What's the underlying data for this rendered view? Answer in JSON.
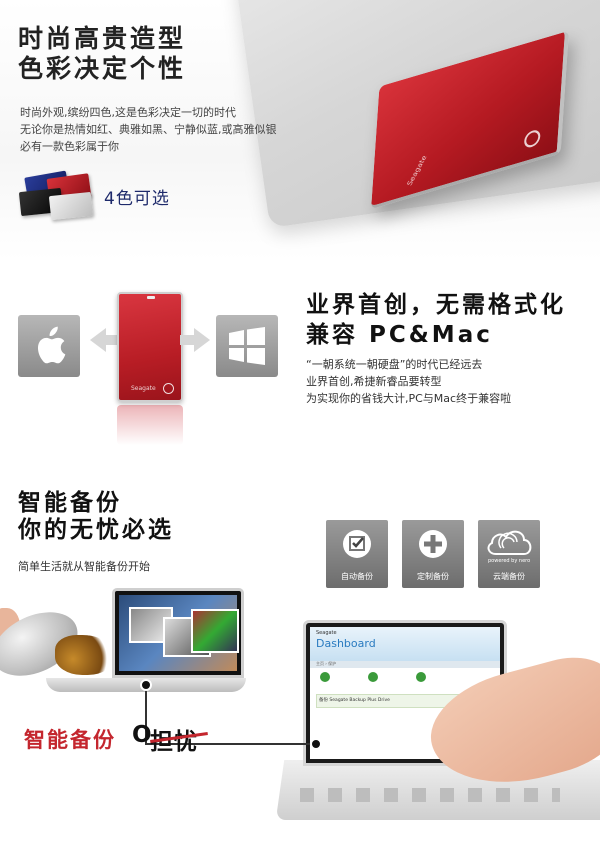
{
  "section1": {
    "title_line1": "时尚高贵造型",
    "title_line2": "色彩决定个性",
    "desc_line1": "时尚外观,缤纷四色,这是色彩决定一切的时代",
    "desc_line2": "无论你是热情如红、典雅如黑、宁静似蓝,或高雅似银",
    "desc_line3": "必有一款色彩属于你",
    "color_count": "4色可选",
    "colors": [
      "#2a3d9a",
      "#c4262e",
      "#111111",
      "#d9d9d9"
    ],
    "drive_brand": "Seagate"
  },
  "section2": {
    "title_line1": "业界首创，无需格式化",
    "title_line2": "兼容 PC&Mac",
    "desc_line1": "“一朝系统一朝硬盘”的时代已经远去",
    "desc_line2": "业界首创,希捷新睿品要转型",
    "desc_line3": "为实现你的省钱大计,PC与Mac终于兼容啦",
    "drive_brand": "Seagate",
    "left_icon": "apple-icon",
    "right_icon": "windows-icon"
  },
  "section3": {
    "title_line1": "智能备份",
    "title_line2": "你的无忧必选",
    "desc": "简单生活就从智能备份开始",
    "features": [
      {
        "label": "自动备份",
        "icon": "auto-backup-icon"
      },
      {
        "label": "定制备份",
        "icon": "plus-icon"
      },
      {
        "label": "云端备份",
        "icon": "cloud-icon"
      }
    ],
    "powered_by": "powered by nero",
    "dashboard": {
      "brand": "Seagate",
      "title": "Dashboard",
      "breadcrumb": "主页 › 保护",
      "row_text": "备份 Seagate Backup Plus Drive"
    },
    "slogan_red": "智能备份",
    "slogan_o": "O",
    "slogan_worry": "担忧"
  }
}
